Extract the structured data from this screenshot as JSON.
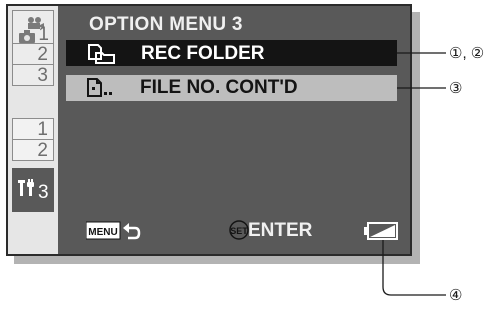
{
  "menu": {
    "title": "OPTION MENU 3",
    "items": [
      {
        "label": "REC FOLDER",
        "icon": "folder-icon",
        "selected": true
      },
      {
        "label": "FILE NO. CONT'D",
        "icon": "file-numbering-icon",
        "selected": false
      }
    ]
  },
  "tabs": {
    "video_icon": "video-camera-icon",
    "photo_icon": "camera-icon",
    "photo": [
      "1",
      "2",
      "3"
    ],
    "play": [
      "1",
      "2"
    ],
    "option": {
      "icon": "tools-icon",
      "num": "3"
    }
  },
  "footer": {
    "menu_icon": "menu-back-icon",
    "set_icon": "set-button-icon",
    "enter_label": "ENTER",
    "battery_icon": "battery-icon"
  },
  "callouts": [
    "①, ②",
    "③",
    "④"
  ],
  "colors": {
    "screen_bg": "#595959",
    "selected_row": "#141414",
    "row_bg": "#bdbdbd",
    "tab_bg": "#e6e6e6"
  }
}
